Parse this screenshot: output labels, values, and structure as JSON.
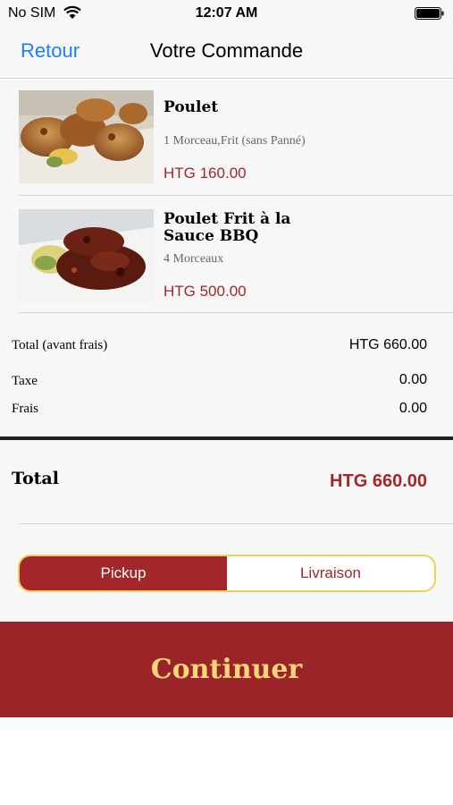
{
  "status_bar": {
    "carrier": "No SIM",
    "time": "12:07 AM"
  },
  "nav": {
    "back_label": "Retour",
    "title": "Votre Commande"
  },
  "items": [
    {
      "name": "Poulet",
      "description": "1 Morceau,Frit (sans Panné)",
      "price": "HTG 160.00",
      "image": "fried-chicken-photo"
    },
    {
      "name": "Poulet Frit à la Sauce BBQ",
      "description": "4 Morceaux",
      "price": "HTG 500.00",
      "image": "bbq-chicken-photo"
    }
  ],
  "summary": {
    "subtotal_label": "Total (avant frais)",
    "subtotal_value": "HTG 660.00",
    "tax_label": "Taxe",
    "tax_value": "0.00",
    "fees_label": "Frais",
    "fees_value": "0.00"
  },
  "total": {
    "label": "Total",
    "value": "HTG 660.00"
  },
  "delivery_mode": {
    "options": [
      "Pickup",
      "Livraison"
    ],
    "selected": "Pickup"
  },
  "continue_label": "Continuer",
  "colors": {
    "accent": "#a3262b",
    "button_bg": "#9b2428",
    "button_text": "#f7d57a",
    "segment_border": "#f0cf57",
    "link": "#1f7ff4"
  }
}
